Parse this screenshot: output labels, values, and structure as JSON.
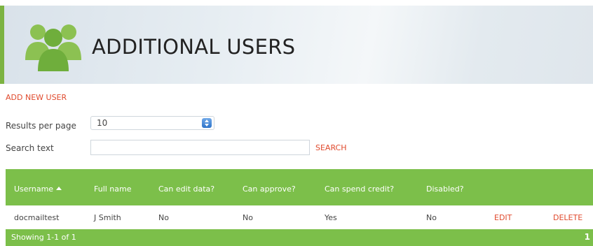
{
  "header": {
    "title": "ADDITIONAL USERS",
    "icon": "users-group-icon",
    "accent_color": "#7cb342"
  },
  "actions": {
    "add_new_user": "ADD NEW USER"
  },
  "filters": {
    "results_per_page_label": "Results per page",
    "results_per_page_value": "10",
    "search_label": "Search text",
    "search_value": "",
    "search_button": "SEARCH"
  },
  "table": {
    "columns": [
      "Username",
      "Full name",
      "Can edit data?",
      "Can approve?",
      "Can spend credit?",
      "Disabled?"
    ],
    "sort_column": "Username",
    "sort_direction": "ascending",
    "rows": [
      {
        "username": "docmailtest",
        "full_name": "J Smith",
        "can_edit": "No",
        "can_approve": "No",
        "can_spend": "Yes",
        "disabled": "No",
        "edit": "EDIT",
        "delete": "DELETE"
      }
    ],
    "footer_text": "Showing 1-1 of 1",
    "page": "1",
    "header_color": "#7cbf4a",
    "link_color": "#e04a2d"
  }
}
